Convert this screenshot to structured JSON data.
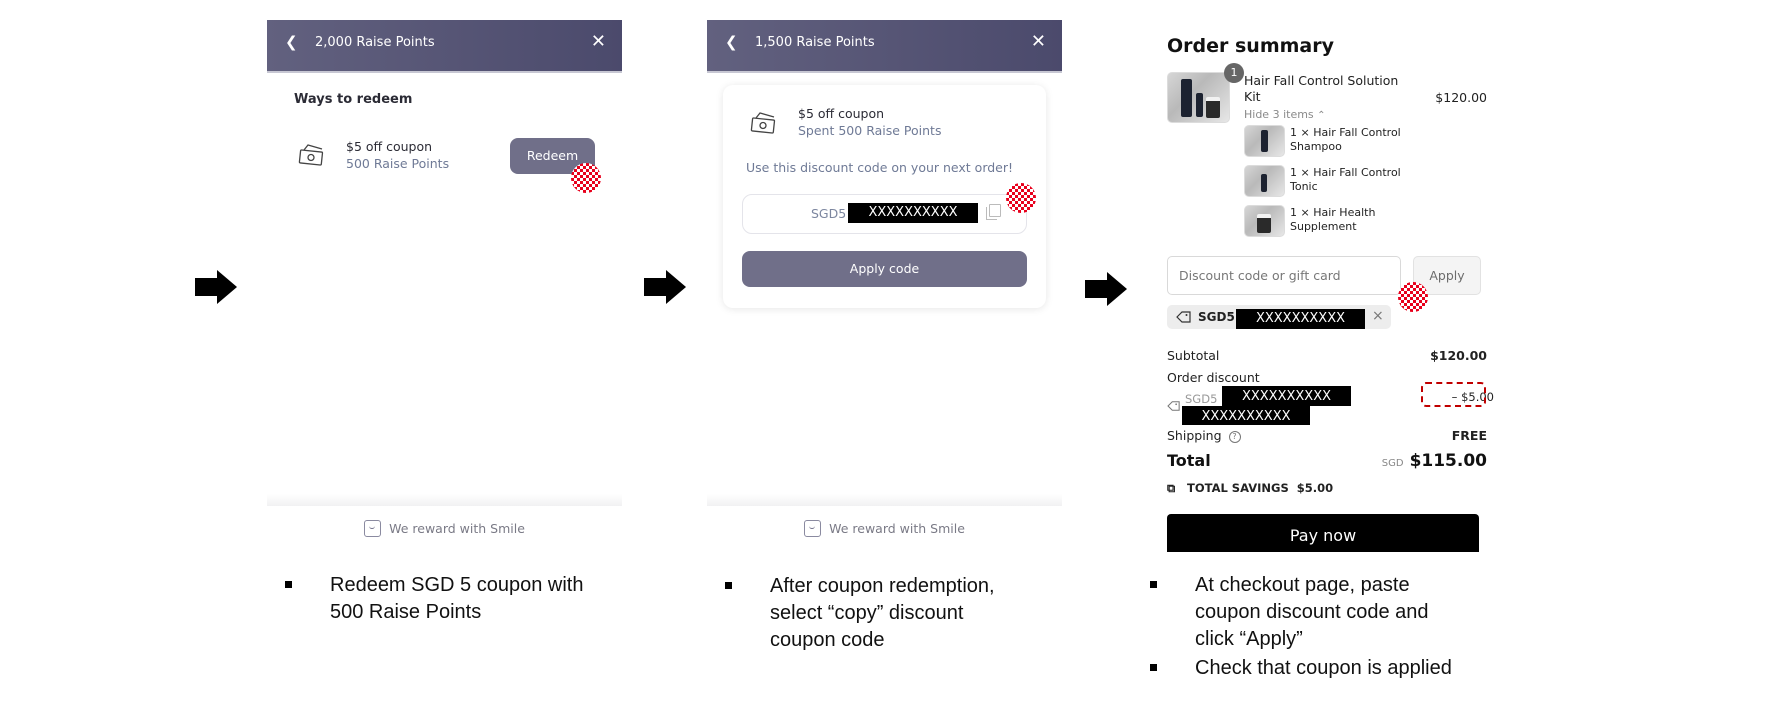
{
  "arrows": [
    "arrow-right",
    "arrow-right",
    "arrow-right"
  ],
  "step1": {
    "header": {
      "back_icon": "chevron-left-icon",
      "title": "2,000 Raise Points",
      "close_icon": "close-icon"
    },
    "section_title": "Ways to redeem",
    "reward": {
      "icon": "cash-bill-icon",
      "name": "$5 off coupon",
      "cost": "500 Raise Points",
      "button": "Redeem"
    },
    "footer": {
      "icon": "smile-icon",
      "text": "We reward with Smile"
    },
    "caption": [
      "Redeem SGD 5 coupon with",
      "500 Raise Points"
    ]
  },
  "step2": {
    "header": {
      "back_icon": "chevron-left-icon",
      "title": "1,500 Raise Points",
      "close_icon": "close-icon"
    },
    "reward": {
      "icon": "cash-bill-icon",
      "name": "$5 off coupon",
      "spent": "Spent 500 Raise Points"
    },
    "instruction": "Use this discount code on your next order!",
    "code_prefix": "SGD5",
    "code_redacted": "XXXXXXXXXX",
    "copy_icon": "copy-icon",
    "apply_button": "Apply code",
    "footer": {
      "icon": "smile-icon",
      "text": "We reward with Smile"
    },
    "caption": [
      "After coupon redemption,",
      "select “copy” discount",
      "coupon code"
    ]
  },
  "step3": {
    "title": "Order summary",
    "product": {
      "name_line1": "Hair Fall Control Solution",
      "name_line2": "Kit",
      "quantity_badge": "1",
      "price": "$120.00",
      "toggle": "Hide 3 items",
      "toggle_icon": "chevron-up-icon",
      "components": [
        {
          "line1": "1 × Hair Fall Control",
          "line2": "Shampoo"
        },
        {
          "line1": "1 × Hair Fall Control",
          "line2": "Tonic"
        },
        {
          "line1": "1 × Hair Health",
          "line2": "Supplement"
        }
      ]
    },
    "discount_input": {
      "placeholder": "Discount code or gift card",
      "apply": "Apply"
    },
    "applied_chip": {
      "icon": "tag-icon",
      "prefix": "SGD5",
      "redacted": "XXXXXXXXXX",
      "remove_icon": "close-icon"
    },
    "subtotal": {
      "label": "Subtotal",
      "value": "$120.00"
    },
    "order_discount": {
      "label": "Order discount",
      "code_prefix": "SGD5",
      "redacted_1": "XXXXXXXXXX",
      "redacted_2": "XXXXXXXXXX",
      "value": "– $5.00"
    },
    "shipping": {
      "label": "Shipping",
      "help_icon": "help-circle-icon",
      "value": "FREE"
    },
    "total": {
      "label": "Total",
      "currency": "SGD",
      "value": "$115.00"
    },
    "savings": {
      "icon": "tags-icon",
      "label": "TOTAL SAVINGS",
      "value": "$5.00"
    },
    "pay_button": "Pay now",
    "captions": [
      [
        "At checkout page, paste",
        "coupon discount code and",
        "click “Apply”"
      ],
      [
        "Check that coupon is applied"
      ]
    ]
  },
  "colors": {
    "header": "#5a5978",
    "button": "#706f89",
    "highlight": "#c00000",
    "click_marker": "#e8001c"
  }
}
